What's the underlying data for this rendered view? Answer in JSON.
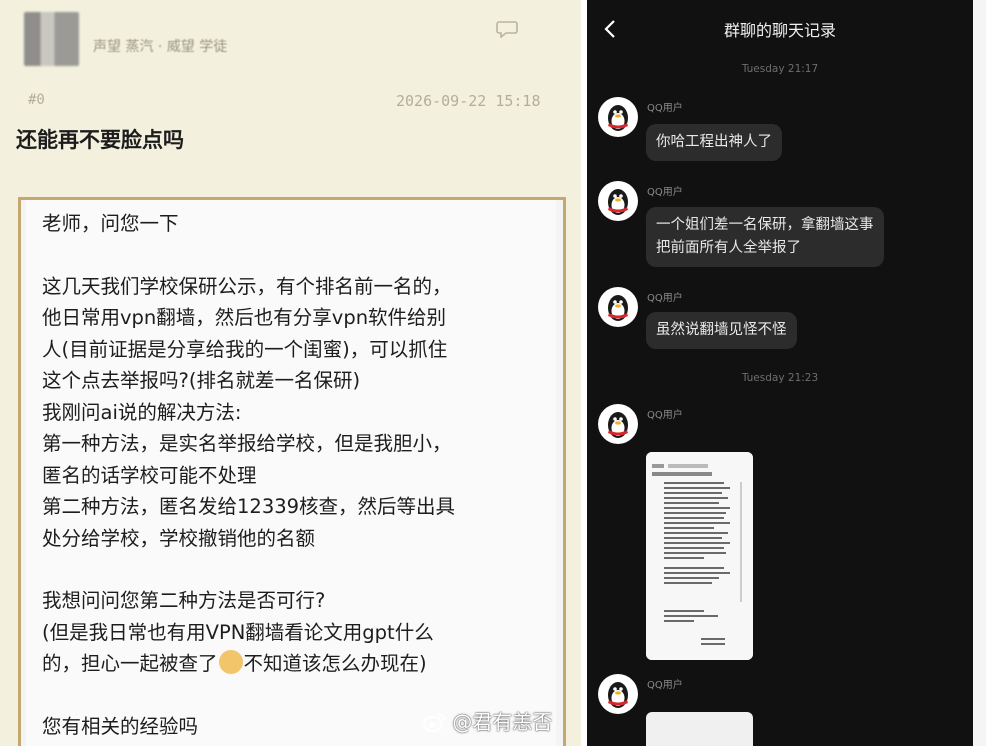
{
  "left": {
    "header_line": "声望 蒸汽 · 威望 学徒",
    "post_number": "#0",
    "post_date": "2026-09-22 15:18",
    "post_title": "还能再不要脸点吗",
    "message_lines": [
      "老师，问您一下",
      "",
      "这几天我们学校保研公示，有个排名前一名的，",
      "他日常用vpn翻墙，然后也有分享vpn软件给别",
      "人(目前证据是分享给我的一个闺蜜)，可以抓住",
      "这个点去举报吗?(排名就差一名保研)",
      "我刚问ai说的解决方法:",
      "第一种方法，是实名举报给学校，但是我胆小，",
      "匿名的话学校可能不处理",
      "第二种方法，匿名发给12339核查，然后等出具",
      "处分给学校，学校撤销他的名额",
      "",
      "我想问问您第二种方法是否可行?",
      "(但是我日常也有用VPN翻墙看论文用gpt什么",
      "的，担心一起被查了",
      "",
      "您有相关的经验吗"
    ],
    "line_after_emoji": "不知道该怎么办现在)"
  },
  "chat": {
    "title": "群聊的聊天记录",
    "timestamp_1": "Tuesday 21:17",
    "timestamp_2": "Tuesday 21:23",
    "sender": "QQ用户",
    "messages": [
      "你哈工程出神人了",
      "一个姐们差一名保研，拿翻墙这事",
      "把前面所有人全举报了",
      "虽然说翻墙见怪不怪"
    ]
  },
  "watermark": "@君有恙否"
}
